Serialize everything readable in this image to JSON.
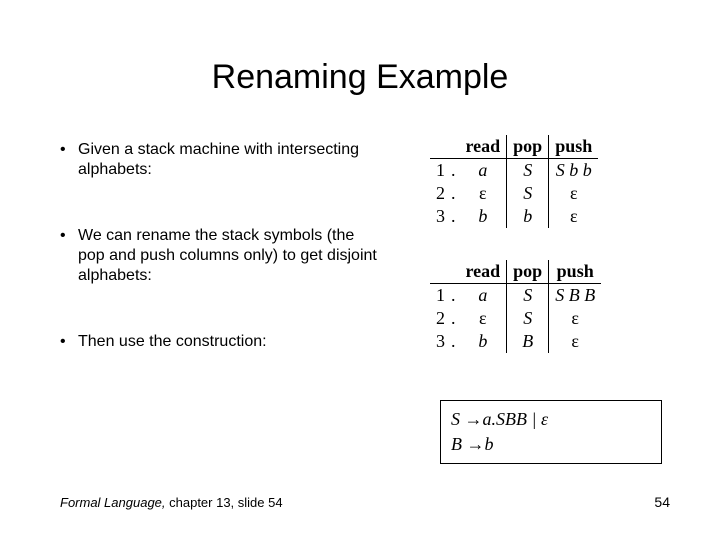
{
  "title": "Renaming Example",
  "bullets": {
    "b1": "Given a stack machine with intersecting alphabets:",
    "b2": "We can rename the stack symbols (the pop and push columns only) to get disjoint alphabets:",
    "b3": "Then use the construction:"
  },
  "table_headers": {
    "read": "read",
    "pop": "pop",
    "push": "push"
  },
  "row_numbers": {
    "r1": "1",
    "r2": "2",
    "r3": "3",
    "dot": "."
  },
  "table1": {
    "r1": {
      "read": "a",
      "pop": "S",
      "push": "S b b"
    },
    "r2": {
      "read": "ε",
      "pop": "S",
      "push": "ε"
    },
    "r3": {
      "read": "b",
      "pop": "b",
      "push": "ε"
    }
  },
  "table2": {
    "r1": {
      "read": "a",
      "pop": "S",
      "push": "S B B"
    },
    "r2": {
      "read": "ε",
      "pop": "S",
      "push": "ε"
    },
    "r3": {
      "read": "b",
      "pop": "B",
      "push": "ε"
    }
  },
  "grammar": {
    "line1_lhs": "S ",
    "arrow": "→",
    "line1_rhs": "a.SBB | ε",
    "line2_lhs": "B ",
    "line2_rhs": "b"
  },
  "footer": {
    "book": "Formal Language,",
    "rest": " chapter 13, slide 54",
    "pagenum": "54"
  },
  "chart_data": [
    {
      "type": "table",
      "title": "Stack machine (intersecting alphabets)",
      "columns": [
        "read",
        "pop",
        "push"
      ],
      "rows": [
        [
          "a",
          "S",
          "Sbb"
        ],
        [
          "ε",
          "S",
          "ε"
        ],
        [
          "b",
          "b",
          "ε"
        ]
      ]
    },
    {
      "type": "table",
      "title": "Renamed stack machine (disjoint alphabets)",
      "columns": [
        "read",
        "pop",
        "push"
      ],
      "rows": [
        [
          "a",
          "S",
          "SBB"
        ],
        [
          "ε",
          "S",
          "ε"
        ],
        [
          "b",
          "B",
          "ε"
        ]
      ]
    }
  ]
}
